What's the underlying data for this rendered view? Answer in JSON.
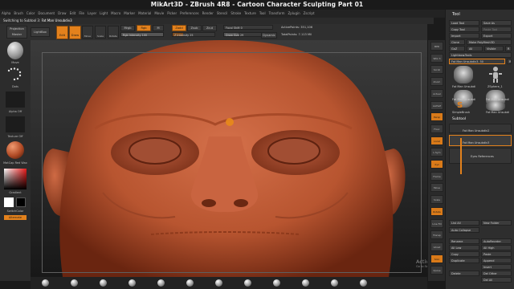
{
  "title": "MikArt3D - ZBrush 4R8 - Cartoon Character Sculpting Part 01",
  "menu": [
    "Alpha",
    "Brush",
    "Color",
    "Document",
    "Draw",
    "Edit",
    "File",
    "Layer",
    "Light",
    "Macro",
    "Marker",
    "Material",
    "Movie",
    "Picker",
    "Preferences",
    "Render",
    "Stencil",
    "Stroke",
    "Texture",
    "Tool",
    "Transform",
    "Zplugin",
    "Zscript"
  ],
  "note": {
    "prefix": "Switching to Subtool 3:",
    "name": "Fat Man Unsubdiv3"
  },
  "top_shelf": {
    "projection_master": "Projection Master",
    "lightbox": "LightBox",
    "edit": "Edit",
    "draw": "Draw",
    "move": "Move",
    "scale": "Scale",
    "rotate": "Rotate",
    "mrgb": "Mrgb",
    "rgb": "Rgb",
    "m": "M",
    "rgb_intensity": "Rgb Intensity 100",
    "zadd": "Zadd",
    "zsub": "Zsub",
    "zcut": "Zcut",
    "z_intensity": "Z Intensity 25",
    "focal_shift": "Focal Shift 0",
    "draw_size": "Draw Size 29",
    "dynamic": "Dynamic",
    "active_points": "ActivePoints: 351,106",
    "total_points": "TotalPoints: 7.113 Mil"
  },
  "left_shelf": {
    "brush": "Move",
    "stroke": "Dots",
    "alpha": "Alpha Off",
    "texture": "Texture Off",
    "material": "MatCap Red Wax",
    "gradient": "Gradient",
    "switch_color": "SwitchColor",
    "alternate": "Alternate"
  },
  "right_shelf": [
    "BPR",
    "SPix 3",
    "Scroll",
    "Zoom",
    "Actual",
    "AAHalf",
    "Persp",
    "Floor",
    "Local",
    "L.Sym",
    "Xyz",
    "Frame",
    "Move",
    "Scale",
    "Rotate",
    "Line Fill PolyF",
    "Transp",
    "Ghost",
    "Solo",
    "Xpose"
  ],
  "tray": {
    "header": "Tool",
    "load_tool": "Load Tool",
    "save_as": "Save As",
    "copy_tool": "Copy Tool",
    "paste_tool": "Paste Tool",
    "import": "Import",
    "export": "Export",
    "clone": "Clone",
    "make_polymesh": "Make PolyMesh3D",
    "goz": "GoZ",
    "all": "All",
    "visible": "Visible",
    "r": "R",
    "lightbox_tools": "Lightbox▸Tools",
    "current_tool": "Fat Man Unsubdiv3. 50",
    "r2": "R",
    "thumb1": "Fat Man Unsubdi",
    "thumb2": "ZSphere_1",
    "thumb3": "Fat Man Unsubdi",
    "thumb4": "Fat Man Unsubdi",
    "thumb5": "SimpleBrush",
    "thumb6": "Fat Man Unsubdi",
    "subtool": "Subtool",
    "subtool1": "Fat Man Unsubdiv2",
    "subtool2": "Fat Man Unsubdiv3",
    "subtool3": "Eyes References",
    "list_all": "List All",
    "new_folder": "New Folder",
    "auto_collapse": "Auto Collapse",
    "rename": "Rename",
    "autoreorder": "AutoReorder",
    "all_low": "All Low",
    "all_high": "All High",
    "copy": "Copy",
    "paste": "Paste",
    "duplicate": "Duplicate",
    "append": "Append",
    "insert": "Insert",
    "delete": "Delete",
    "del_other": "Del Other",
    "del_all": "Del All"
  },
  "watermark": {
    "line1": "Activate Windows",
    "line2": "Go to Settings to activate Windows."
  },
  "colors": {
    "accent": "#e3811c",
    "skin": "#c8623a",
    "ui_dark": "#2e2e2e"
  }
}
